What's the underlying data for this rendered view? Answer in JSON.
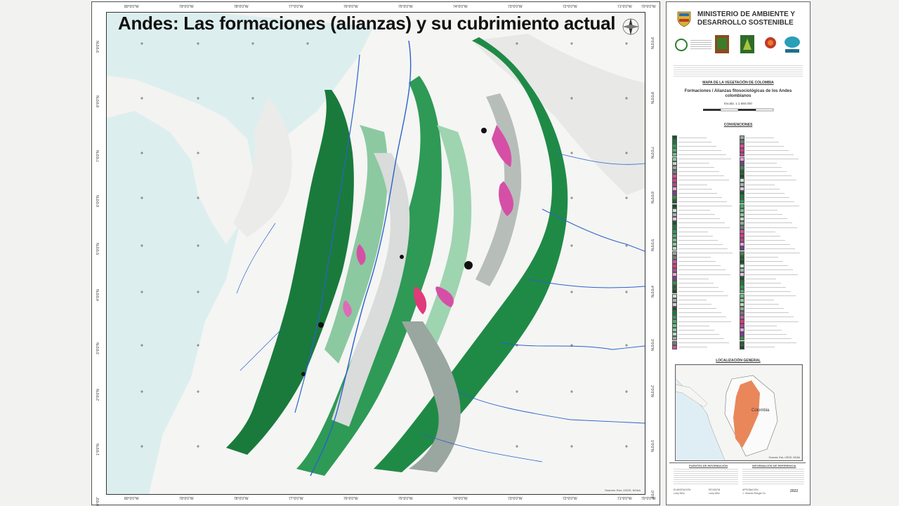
{
  "slide": {
    "title": "Andes: Las formaciones (alianzas) y su cubrimiento actual"
  },
  "map": {
    "top_ticks": [
      "80°0'0\"W",
      "79°0'0\"W",
      "78°0'0\"W",
      "77°0'0\"W",
      "76°0'0\"W",
      "75°0'0\"W",
      "74°0'0\"W",
      "73°0'0\"W",
      "72°0'0\"W",
      "71°0'0\"W",
      "70°0'0\"W"
    ],
    "bottom_ticks": [
      "80°0'0\"W",
      "79°0'0\"W",
      "78°0'0\"W",
      "77°0'0\"W",
      "76°0'0\"W",
      "75°0'0\"W",
      "74°0'0\"W",
      "73°0'0\"W",
      "72°0'0\"W",
      "71°0'0\"W",
      "70°0'0\"W"
    ],
    "lat_ticks": [
      "9°0'0\"N",
      "8°0'0\"N",
      "7°0'0\"N",
      "6°0'0\"N",
      "5°0'0\"N",
      "4°0'0\"N",
      "3°0'0\"N",
      "2°0'0\"N",
      "1°0'0\"N",
      "0°0'0\""
    ],
    "source_note": "Sources: Esri, USGS, NOAA",
    "colors": {
      "sea": "#dcefee",
      "land": "#f4f4f4",
      "forest_dark": "#1a7a3c",
      "forest_mid": "#2e9a56",
      "forest_light": "#8cc9a0",
      "grey": "#9aa6a0",
      "pink": "#d64fa6",
      "magenta": "#e03a7a",
      "river": "#2a62c9"
    }
  },
  "legend": {
    "ministry": "MINISTERIO DE AMBIENTE Y DESARROLLO SOSTENIBLE",
    "map_title": "MAPA DE LA VEGETACIÓN DE COLOMBIA",
    "map_subtitle": "Formaciones / Alianzas fitosociológicas de los Andes colombianos",
    "scale": "Escala: 1:1.650.000",
    "conventions": "CONVENCIONES",
    "localization": "LOCALIZACIÓN GENERAL",
    "inset_label": "Colombia",
    "inset_source": "Sources: Esri, USGS, NOAA",
    "fuentes": "FUENTES DE INFORMACIÓN",
    "referencia": "INFORMACIÓN DE REFERENCIA",
    "elaboracion": "ELABORACIÓN",
    "revision": "REVISIÓN",
    "aprobacion": "APROBACIÓN",
    "year": "2022",
    "elaborado_por": "Larry Niño",
    "revisado_por": "Larry Niño",
    "aprobado_por": "J. Orlando Rangel-Ch."
  }
}
